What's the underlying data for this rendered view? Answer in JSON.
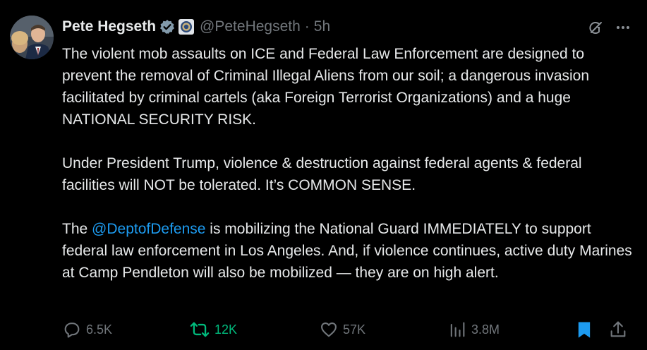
{
  "author": {
    "name": "Pete Hegseth",
    "handle": "@PeteHegseth",
    "time": "5h",
    "separator": "·"
  },
  "colors": {
    "background": "#000000",
    "text": "#e7e9ea",
    "muted": "#71767b",
    "link": "#1d9bf0",
    "verified": "#829aab",
    "repost": "#00ba7c",
    "bookmark": "#1d9bf0"
  },
  "icons": {
    "verified": "verified-badge-icon",
    "affiliation": "seal-icon",
    "grok": "grok-icon",
    "more": "more-icon",
    "reply": "reply-icon",
    "repost": "repost-icon",
    "like": "heart-icon",
    "views": "views-icon",
    "bookmark": "bookmark-icon",
    "share": "share-icon"
  },
  "body": {
    "p1": "The violent mob assaults on ICE and Federal Law Enforcement are designed to prevent the removal of Criminal Illegal Aliens from our soil; a dangerous invasion facilitated by criminal cartels (aka Foreign Terrorist Organizations) and a huge NATIONAL SECURITY RISK.",
    "p2": "Under President Trump, violence & destruction against federal agents & federal facilities will NOT be tolerated. It’s COMMON SENSE.",
    "p3_before": "The ",
    "p3_mention": "@DeptofDefense",
    "p3_after": " is mobilizing the National Guard IMMEDIATELY to support federal law enforcement in Los Angeles. And, if violence continues, active duty Marines at Camp Pendleton will also be mobilized — they are on high alert."
  },
  "stats": {
    "replies": "6.5K",
    "reposts": "12K",
    "likes": "57K",
    "views": "3.8M"
  }
}
